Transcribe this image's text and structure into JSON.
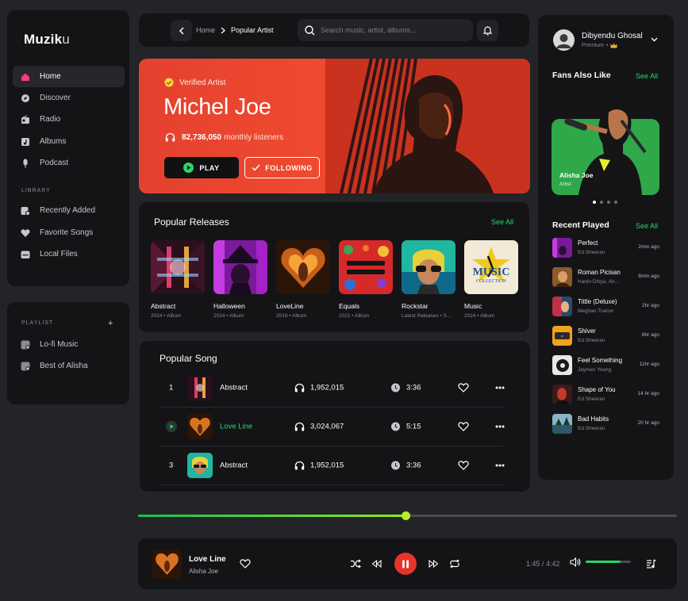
{
  "app": {
    "logo_main": "Muzik",
    "logo_tail": "u"
  },
  "sidebar": {
    "nav": [
      {
        "label": "Home",
        "icon": "home-icon",
        "active": true
      },
      {
        "label": "Discover",
        "icon": "compass-icon"
      },
      {
        "label": "Radio",
        "icon": "radio-icon"
      },
      {
        "label": "Albums",
        "icon": "album-icon"
      },
      {
        "label": "Podcast",
        "icon": "microphone-icon"
      }
    ],
    "library_title": "LIBRARY",
    "library": [
      {
        "label": "Recently Added",
        "icon": "recent-icon"
      },
      {
        "label": "Favorite Songs",
        "icon": "heart-icon"
      },
      {
        "label": "Local Files",
        "icon": "folder-icon"
      }
    ],
    "playlist_title": "PLAYLIST",
    "playlist_add": "+",
    "playlists": [
      {
        "label": "Lo-fi Music"
      },
      {
        "label": "Best of Alisha"
      }
    ]
  },
  "header": {
    "breadcrumb": {
      "root": "Home",
      "current": "Popular Artist"
    },
    "search_placeholder": "Search music, artist, albums..."
  },
  "hero": {
    "badge": "Verified Artist",
    "name": "Michel Joe",
    "listeners": "82,736,050",
    "listeners_suffix": "monthly listeners",
    "play_label": "PLAY",
    "follow_label": "FOLLOWING"
  },
  "releases": {
    "title": "Popular Releases",
    "see_all": "See All",
    "items": [
      {
        "name": "Abstract",
        "meta": "2024 • Album"
      },
      {
        "name": "Halloween",
        "meta": "2024 • Album"
      },
      {
        "name": "LoveLine",
        "meta": "2019 • Album"
      },
      {
        "name": "Equals",
        "meta": "2021 • Album"
      },
      {
        "name": "Rockstar",
        "meta": "Latest Releases • S..."
      },
      {
        "name": "Music",
        "meta": "2024 • Album"
      }
    ],
    "music_cover_top": "MUSIC",
    "music_cover_bottom": "COLLECTION"
  },
  "songs": {
    "title": "Popular Song",
    "rows": [
      {
        "index": "1",
        "title": "Abstract",
        "plays": "1,952,015",
        "duration": "3:36",
        "playing": false
      },
      {
        "index": "",
        "title": "Love Line",
        "plays": "3,024,067",
        "duration": "5:15",
        "playing": true
      },
      {
        "index": "3",
        "title": "Abstract",
        "plays": "1,952,015",
        "duration": "3:36",
        "playing": false
      }
    ]
  },
  "user": {
    "name": "Dibyendu Ghosal",
    "tier": "Premium"
  },
  "fans": {
    "title": "Fans Also Like",
    "see_all": "See All",
    "card_name": "Alisha Joe",
    "card_role": "Artist"
  },
  "recent": {
    "title": "Recent Played",
    "see_all": "See All",
    "items": [
      {
        "title": "Perfect",
        "artist": "Ed Sheeran",
        "ago": "2min ago"
      },
      {
        "title": "Roman Picisan",
        "artist": "Hanin Dhiya, Ah...",
        "ago": "8min ago"
      },
      {
        "title": "Tittle (Deluxe)",
        "artist": "Meghan Trainor",
        "ago": "2hr ago"
      },
      {
        "title": "Shiver",
        "artist": "Ed Sheeran",
        "ago": "6hr ago"
      },
      {
        "title": "Feel Something",
        "artist": "Jaymes Young",
        "ago": "11hr ago"
      },
      {
        "title": "Shape of You",
        "artist": "Ed Sheeran",
        "ago": "14 hr ago"
      },
      {
        "title": "Bad Habits",
        "artist": "Ed Sheeran",
        "ago": "20 hr ago"
      }
    ]
  },
  "player": {
    "title": "Love Line",
    "artist": "Alisha Joe",
    "time": "1:45 / 4:42",
    "progress": 0.497,
    "volume": 0.78
  },
  "colors": {
    "accent": "#2bd46a",
    "hero": "#ef4a2f",
    "pause": "#e8332b"
  }
}
